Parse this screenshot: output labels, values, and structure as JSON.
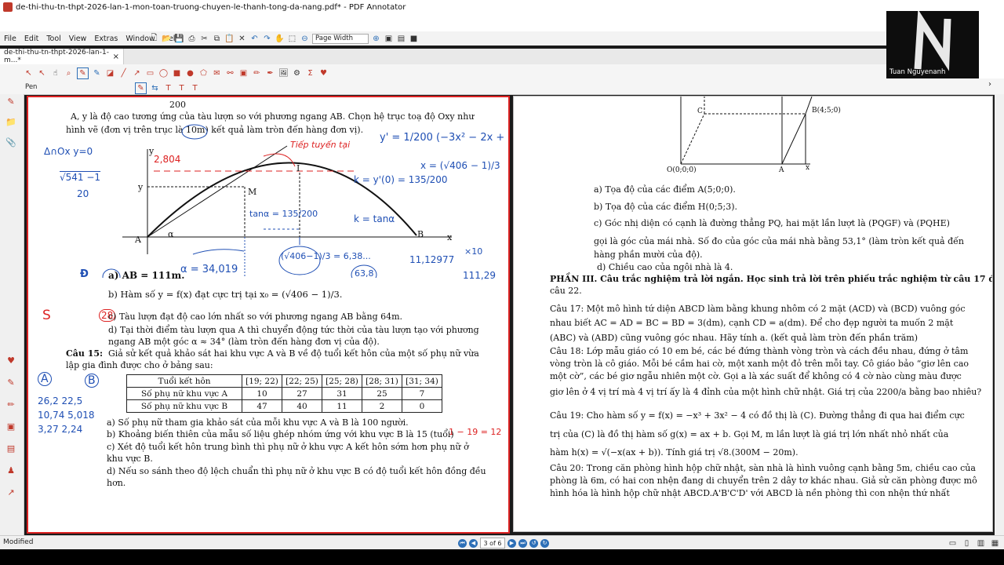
{
  "window": {
    "title": "de-thi-thu-tn-thpt-2026-lan-1-mon-toan-truong-chuyen-le-thanh-tong-da-nang.pdf* - PDF Annotator"
  },
  "menu": [
    "File",
    "Edit",
    "Tool",
    "View",
    "Extras",
    "Window",
    "Help"
  ],
  "zoom": {
    "label": "Page Width"
  },
  "tab": {
    "label": "de-thi-thu-tn-thpt-2026-lan-1-m...*",
    "close": "×"
  },
  "tool": {
    "label": "Pen"
  },
  "webcam": {
    "name": "Tuan Nguyenanh"
  },
  "status": {
    "text": "Modified",
    "page": "3 of 6"
  },
  "left_page": {
    "frac_200": "200",
    "line1": "A, y là độ cao tương ứng của tàu lượn so với phương ngang AB. Chọn hệ trục toạ độ Oxy như",
    "line2": "hình vẽ (đơn vị trên trục là 10m) kết quả làm tròn đến hàng đơn vị).",
    "graph": {
      "labels": [
        "A",
        "B",
        "M",
        "I",
        "x",
        "y",
        "α"
      ]
    },
    "q_a": "a) AB = 111m.",
    "q_b": "b) Hàm số y = f(x) đạt cực trị tại x₀ = (√406 − 1)/3.",
    "q_c": "c) Tàu lượn đạt độ cao lớn nhất so với phương ngang AB bằng 64m.",
    "q_d1": "d) Tại thời điểm tàu lượn qua A thì chuyển động tức thời của tàu lượn tạo với phương",
    "q_d2": "ngang AB một góc α ≈ 34° (làm tròn đến hàng đơn vị của độ).",
    "c15_title": "Câu 15:",
    "c15_l1": "Giả sử kết quả khảo sát hai khu vực A và B về độ tuổi kết hôn của một số phụ nữ vừa",
    "c15_l2": "lập gia đình được cho ở bảng sau:",
    "table": {
      "header": [
        "Tuổi kết hôn",
        "[19; 22)",
        "[22; 25)",
        "[25; 28)",
        "[28; 31)",
        "[31; 34)"
      ],
      "rows": [
        [
          "Số phụ nữ khu vực A",
          "10",
          "27",
          "31",
          "25",
          "7"
        ],
        [
          "Số phụ nữ khu vực B",
          "47",
          "40",
          "11",
          "2",
          "0"
        ]
      ]
    },
    "c15_a": "a) Số phụ nữ tham gia khảo sát của mỗi khu vực A và B là 100 người.",
    "c15_b": "b) Khoảng biến thiên của mẫu số liệu ghép nhóm ứng với khu vực B là 15 (tuổi)",
    "c15_c1": "c) Xét độ tuổi kết hôn trung bình thì phụ nữ ở khu vực A kết hôn sớm hơn phụ nữ ở",
    "c15_c2": "khu vực B.",
    "c15_d1": "d) Nếu so sánh theo độ lệch chuẩn thì phụ nữ ở khu vực B có độ tuổi kết hôn đồng đều",
    "c15_d2": "hơn.",
    "ink": {
      "n1": "Δ∩Ox  y=0",
      "n2": "√541 −1",
      "n3": "20",
      "n4": "2,804",
      "n5": "Tiếp tuyến tại",
      "n6": "y' = 1/200 (−3x² − 2x + 135)",
      "n7": "x = (√406 − 1)/3",
      "n8": "k = y'(0) = 135/200",
      "n9": "k = tanα",
      "n10": "tanα = 135/200",
      "n11": "α = 34,019",
      "n12": "(√406−1)/3 = 6,38...",
      "n13": "63,8",
      "n14": "11,12977",
      "n15": "×10",
      "n16": "111,29",
      "n17": "S",
      "n18": "Đ",
      "n19": "A",
      "n20": "B",
      "n21": "26,2   22,5",
      "n22": "10,74  5,018",
      "n23": "3,27   2,24",
      "n24": "1 − 19 = 12",
      "n25": "28"
    }
  },
  "right_page": {
    "fig_labels": {
      "c": "C",
      "b": "B(4;5;0)",
      "o": "O(0;0;0)",
      "a": "A",
      "x": "x"
    },
    "a": "a) Tọa độ của các điểm A(5;0;0).",
    "b": "b) Tọa độ của các điểm H(0;5;3).",
    "c1": "c) Góc nhị diện có cạnh là đường thẳng PQ, hai mặt lần lượt là (PQGF) và (PQHE)",
    "c2": "gọi là góc của mái nhà. Số đo của góc của mái nhà bằng 53,1° (làm tròn kết quả đến",
    "c3": "hàng phần mười của độ).",
    "d": "d) Chiều cao của ngôi nhà là 4.",
    "part3_1": "PHẦN III. Câu trắc nghiệm trả lời ngắn. Học sinh trả lời trên phiếu trắc nghiệm từ câu 17 đến",
    "part3_2": "câu 22.",
    "c17_1": "Câu 17: Một mô hình tứ diện ABCD làm bằng khung nhôm có 2 mặt (ACD) và (BCD) vuông góc",
    "c17_2": "nhau biết AC = AD = BC = BD = 3(dm), cạnh CD = a(dm). Để cho đẹp người ta muốn 2 mặt",
    "c17_3": "(ABC) và (ABD) cũng vuông góc nhau. Hãy tính a. (kết quả làm tròn đến phần trăm)",
    "c18_1": "Câu 18: Lớp mẫu giáo có 10 em bé, các bé đứng thành vòng tròn và cách đều nhau, đứng ở tâm",
    "c18_2": "vòng tròn là cô giáo. Mỗi bé cầm hai cờ, một xanh một đỏ trên mỗi tay. Cô giáo bảo “giơ lên cao",
    "c18_3": "một cờ”, các bé giơ ngẫu nhiên một cờ. Gọi a là xác suất để không có 4 cờ nào cùng màu được",
    "c18_4": "giơ lên ở 4 vị trí mà 4 vị trí ấy là 4 đỉnh của một hình chữ nhật. Giá trị của 2200/a bằng bao nhiêu?",
    "c19_1": "Câu 19: Cho hàm số y = f(x) = −x³ + 3x² − 4 có đồ thị là (C). Đường thẳng đi qua hai điểm cực",
    "c19_2": "trị của (C) là đồ thị hàm số g(x) = ax + b. Gọi M, m lần lượt là giá trị lớn nhất nhỏ nhất của",
    "c19_3": "hàm h(x) = √(−x(ax + b)). Tính giá trị √8.(300M − 20m).",
    "c20_1": "Câu 20: Trong căn phòng hình hộp chữ nhật, sàn nhà là hình vuông cạnh bằng 5m, chiều cao của",
    "c20_2": "phòng là 6m, có hai con nhện đang di chuyển trên 2 dây tơ khác nhau. Giả sử căn phòng được mô",
    "c20_3": "hình hóa là hình hộp chữ nhật ABCD.A'B'C'D' với ABCD là nền phòng thì con nhện thứ nhất"
  }
}
